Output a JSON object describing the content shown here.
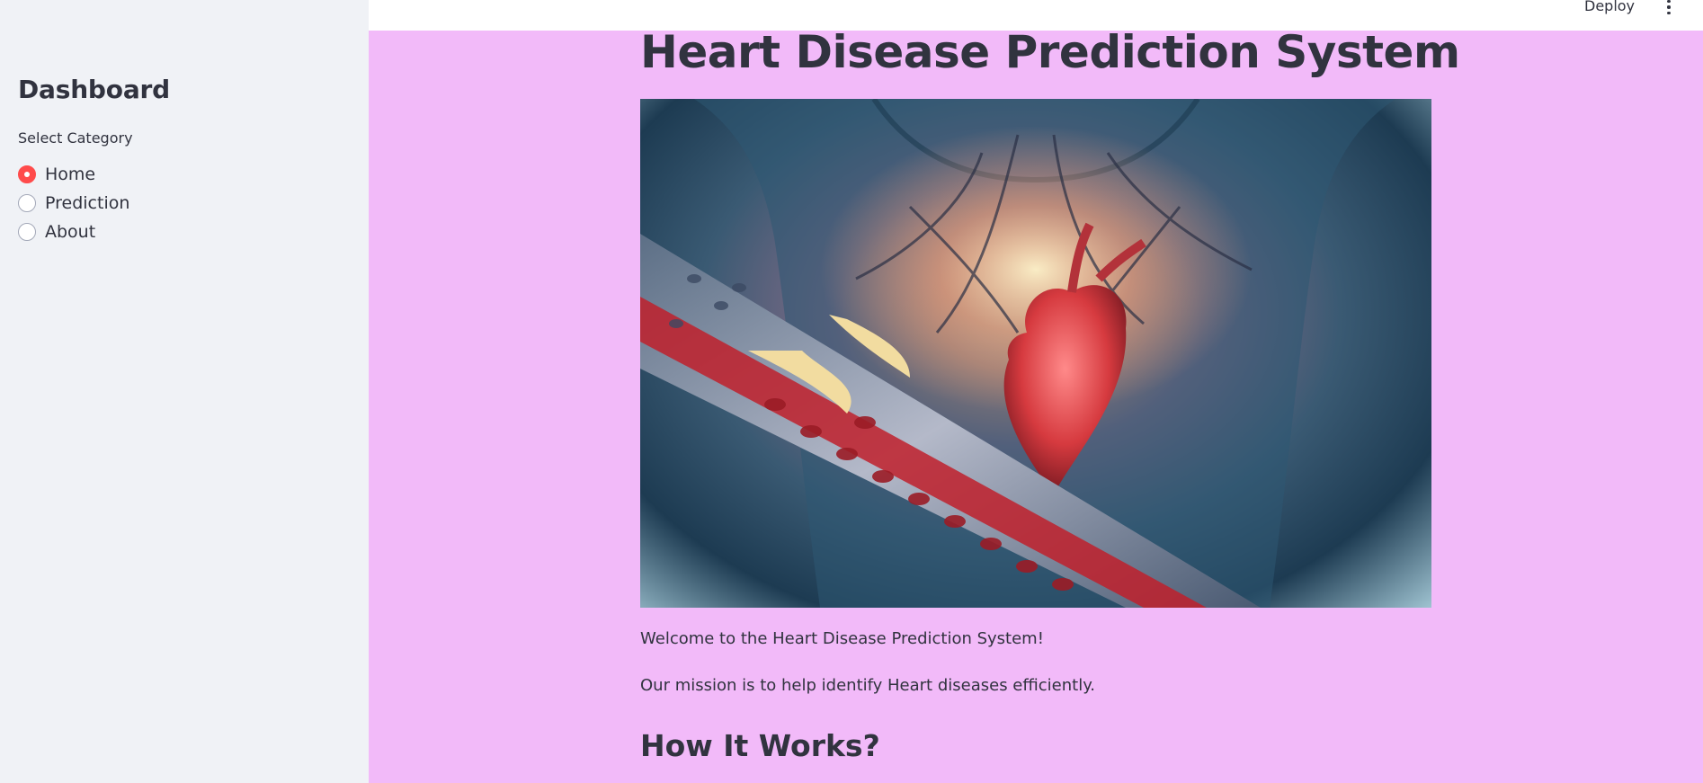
{
  "sidebar": {
    "title": "Dashboard",
    "select_label": "Select Category",
    "options": [
      {
        "label": "Home",
        "selected": true
      },
      {
        "label": "Prediction",
        "selected": false
      },
      {
        "label": "About",
        "selected": false
      }
    ],
    "accent_color": "#ff4b4b"
  },
  "header": {
    "deploy_label": "Deploy",
    "menu_icon": "vertical-ellipsis-icon"
  },
  "main": {
    "title": "Heart Disease Prediction System",
    "hero_image": "heart-anatomy-artery-illustration",
    "welcome": "Welcome to the Heart Disease Prediction System!",
    "mission": "Our mission is to help identify Heart diseases efficiently.",
    "section_heading": "How It Works?",
    "background_color": "#f2baf9"
  }
}
